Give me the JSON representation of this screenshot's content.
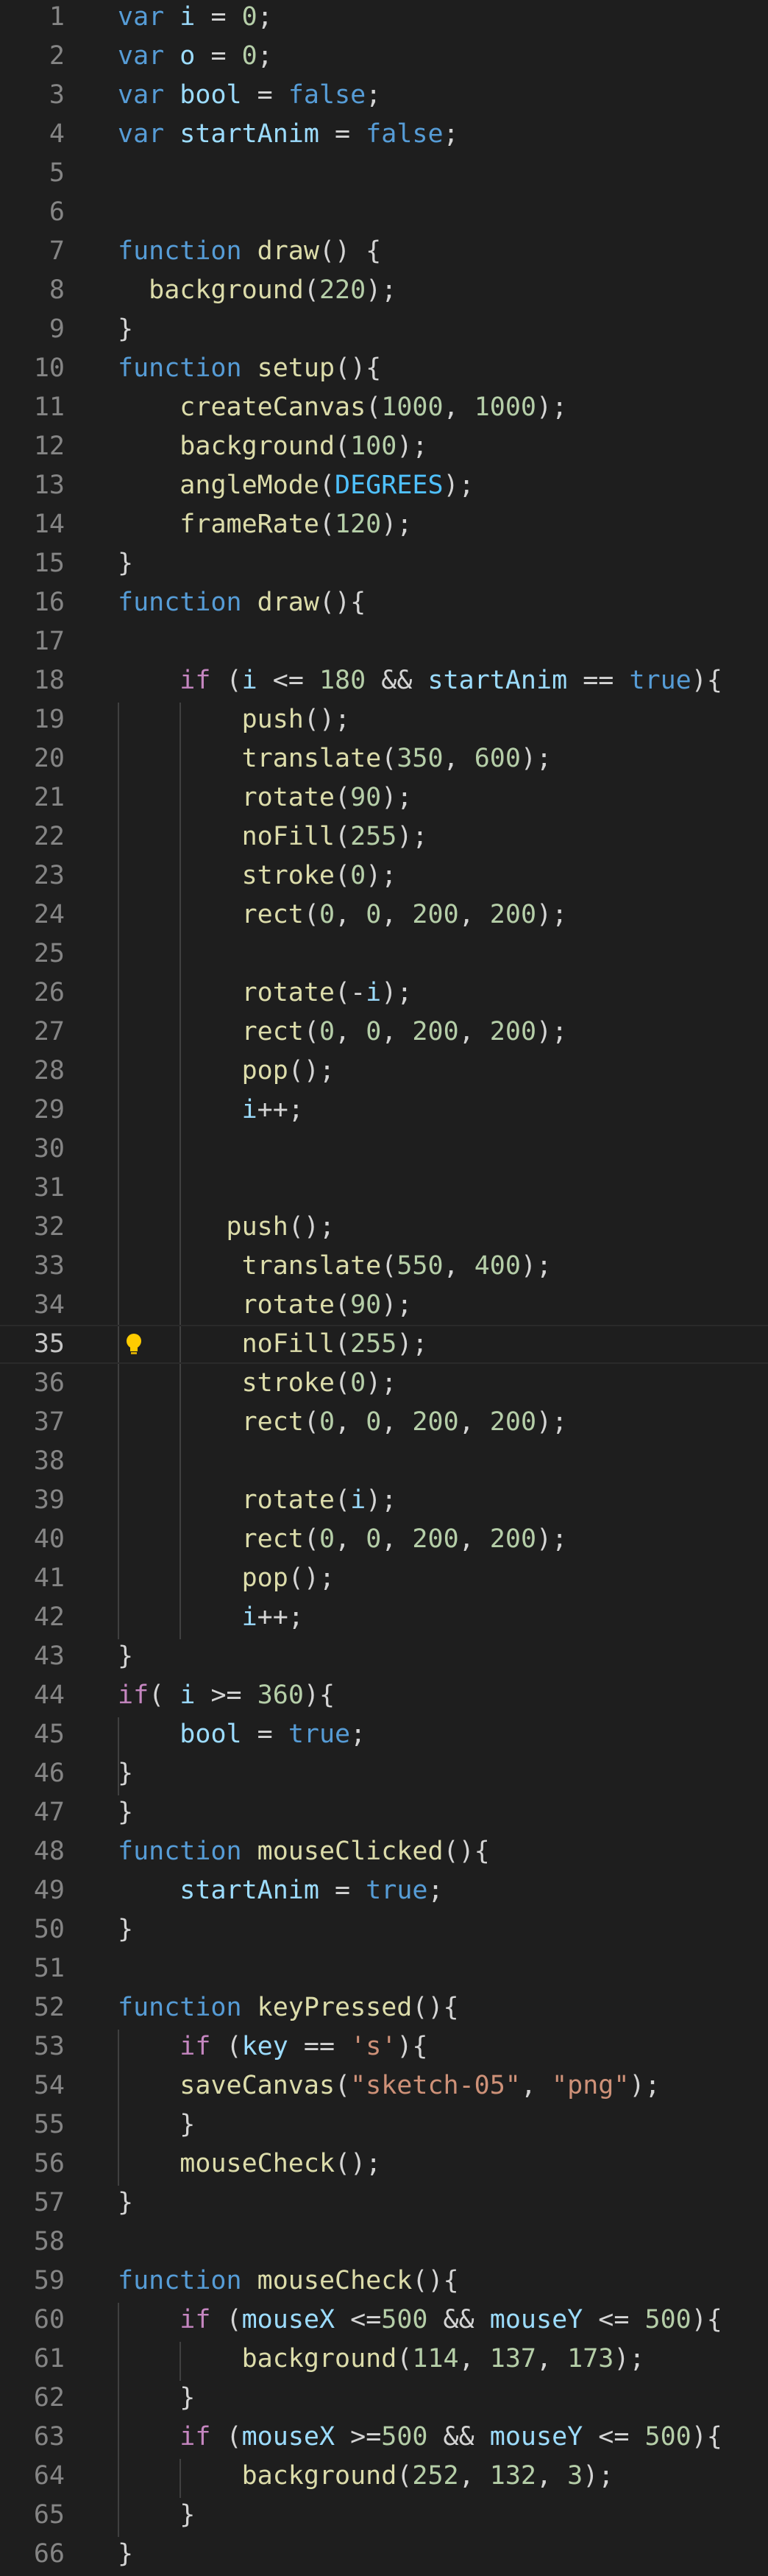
{
  "editor": {
    "current_line": 35,
    "lines": [
      {
        "n": "1",
        "toks": [
          [
            "var",
            "kw"
          ],
          [
            " "
          ],
          [
            "i",
            "var"
          ],
          [
            " = "
          ],
          [
            "0",
            "num"
          ],
          [
            ";"
          ]
        ]
      },
      {
        "n": "2",
        "toks": [
          [
            "var",
            "kw"
          ],
          [
            " "
          ],
          [
            "o",
            "var"
          ],
          [
            " = "
          ],
          [
            "0",
            "num"
          ],
          [
            ";"
          ]
        ]
      },
      {
        "n": "3",
        "toks": [
          [
            "var",
            "kw"
          ],
          [
            " "
          ],
          [
            "bool",
            "var"
          ],
          [
            " = "
          ],
          [
            "false",
            "kw"
          ],
          [
            ";"
          ]
        ]
      },
      {
        "n": "4",
        "toks": [
          [
            "var",
            "kw"
          ],
          [
            " "
          ],
          [
            "startAnim",
            "var"
          ],
          [
            " = "
          ],
          [
            "false",
            "kw"
          ],
          [
            ";"
          ]
        ]
      },
      {
        "n": "5",
        "toks": []
      },
      {
        "n": "6",
        "toks": []
      },
      {
        "n": "7",
        "toks": [
          [
            "function",
            "kw"
          ],
          [
            " "
          ],
          [
            "draw",
            "fn"
          ],
          [
            "() {"
          ]
        ]
      },
      {
        "n": "8",
        "toks": [
          [
            "  "
          ],
          [
            "background",
            "fn"
          ],
          [
            "("
          ],
          [
            "220",
            "num"
          ],
          [
            ");"
          ]
        ]
      },
      {
        "n": "9",
        "toks": [
          [
            "}"
          ]
        ]
      },
      {
        "n": "10",
        "toks": [
          [
            "function",
            "kw"
          ],
          [
            " "
          ],
          [
            "setup",
            "fn"
          ],
          [
            "(){"
          ]
        ]
      },
      {
        "n": "11",
        "toks": [
          [
            "    "
          ],
          [
            "createCanvas",
            "fn"
          ],
          [
            "("
          ],
          [
            "1000",
            "num"
          ],
          [
            ", "
          ],
          [
            "1000",
            "num"
          ],
          [
            ");"
          ]
        ]
      },
      {
        "n": "12",
        "toks": [
          [
            "    "
          ],
          [
            "background",
            "fn"
          ],
          [
            "("
          ],
          [
            "100",
            "num"
          ],
          [
            ");"
          ]
        ]
      },
      {
        "n": "13",
        "toks": [
          [
            "    "
          ],
          [
            "angleMode",
            "fn"
          ],
          [
            "("
          ],
          [
            "DEGREES",
            "con"
          ],
          [
            ");"
          ]
        ]
      },
      {
        "n": "14",
        "toks": [
          [
            "    "
          ],
          [
            "frameRate",
            "fn"
          ],
          [
            "("
          ],
          [
            "120",
            "num"
          ],
          [
            ");"
          ]
        ]
      },
      {
        "n": "15",
        "toks": [
          [
            "}"
          ]
        ]
      },
      {
        "n": "16",
        "toks": [
          [
            "function",
            "kw"
          ],
          [
            " "
          ],
          [
            "draw",
            "fn"
          ],
          [
            "(){"
          ]
        ]
      },
      {
        "n": "17",
        "toks": []
      },
      {
        "n": "18",
        "toks": [
          [
            "    "
          ],
          [
            "if",
            "ctl"
          ],
          [
            " ("
          ],
          [
            "i",
            "var"
          ],
          [
            " <= "
          ],
          [
            "180",
            "num"
          ],
          [
            " && "
          ],
          [
            "startAnim",
            "var"
          ],
          [
            " == "
          ],
          [
            "true",
            "kw"
          ],
          [
            "){"
          ]
        ]
      },
      {
        "n": "19",
        "toks": [
          [
            "        "
          ],
          [
            "push",
            "fn"
          ],
          [
            "();"
          ]
        ]
      },
      {
        "n": "20",
        "toks": [
          [
            "        "
          ],
          [
            "translate",
            "fn"
          ],
          [
            "("
          ],
          [
            "350",
            "num"
          ],
          [
            ", "
          ],
          [
            "600",
            "num"
          ],
          [
            ");"
          ]
        ]
      },
      {
        "n": "21",
        "toks": [
          [
            "        "
          ],
          [
            "rotate",
            "fn"
          ],
          [
            "("
          ],
          [
            "90",
            "num"
          ],
          [
            ");"
          ]
        ]
      },
      {
        "n": "22",
        "toks": [
          [
            "        "
          ],
          [
            "noFill",
            "fn"
          ],
          [
            "("
          ],
          [
            "255",
            "num"
          ],
          [
            ");"
          ]
        ]
      },
      {
        "n": "23",
        "toks": [
          [
            "        "
          ],
          [
            "stroke",
            "fn"
          ],
          [
            "("
          ],
          [
            "0",
            "num"
          ],
          [
            ");"
          ]
        ]
      },
      {
        "n": "24",
        "toks": [
          [
            "        "
          ],
          [
            "rect",
            "fn"
          ],
          [
            "("
          ],
          [
            "0",
            "num"
          ],
          [
            ", "
          ],
          [
            "0",
            "num"
          ],
          [
            ", "
          ],
          [
            "200",
            "num"
          ],
          [
            ", "
          ],
          [
            "200",
            "num"
          ],
          [
            ");"
          ]
        ]
      },
      {
        "n": "25",
        "toks": []
      },
      {
        "n": "26",
        "toks": [
          [
            "        "
          ],
          [
            "rotate",
            "fn"
          ],
          [
            "(-"
          ],
          [
            "i",
            "var"
          ],
          [
            ");"
          ]
        ]
      },
      {
        "n": "27",
        "toks": [
          [
            "        "
          ],
          [
            "rect",
            "fn"
          ],
          [
            "("
          ],
          [
            "0",
            "num"
          ],
          [
            ", "
          ],
          [
            "0",
            "num"
          ],
          [
            ", "
          ],
          [
            "200",
            "num"
          ],
          [
            ", "
          ],
          [
            "200",
            "num"
          ],
          [
            ");"
          ]
        ]
      },
      {
        "n": "28",
        "toks": [
          [
            "        "
          ],
          [
            "pop",
            "fn"
          ],
          [
            "();"
          ]
        ]
      },
      {
        "n": "29",
        "toks": [
          [
            "        "
          ],
          [
            "i",
            "var"
          ],
          [
            "++;"
          ]
        ]
      },
      {
        "n": "30",
        "toks": []
      },
      {
        "n": "31",
        "toks": []
      },
      {
        "n": "32",
        "toks": [
          [
            "       "
          ],
          [
            "push",
            "fn"
          ],
          [
            "();"
          ]
        ]
      },
      {
        "n": "33",
        "toks": [
          [
            "        "
          ],
          [
            "translate",
            "fn"
          ],
          [
            "("
          ],
          [
            "550",
            "num"
          ],
          [
            ", "
          ],
          [
            "400",
            "num"
          ],
          [
            ");"
          ]
        ]
      },
      {
        "n": "34",
        "toks": [
          [
            "        "
          ],
          [
            "rotate",
            "fn"
          ],
          [
            "("
          ],
          [
            "90",
            "num"
          ],
          [
            ");"
          ]
        ]
      },
      {
        "n": "35",
        "toks": [
          [
            "        "
          ],
          [
            "noFill",
            "fn"
          ],
          [
            "("
          ],
          [
            "255",
            "num"
          ],
          [
            ");"
          ]
        ]
      },
      {
        "n": "36",
        "toks": [
          [
            "        "
          ],
          [
            "stroke",
            "fn"
          ],
          [
            "("
          ],
          [
            "0",
            "num"
          ],
          [
            ");"
          ]
        ]
      },
      {
        "n": "37",
        "toks": [
          [
            "        "
          ],
          [
            "rect",
            "fn"
          ],
          [
            "("
          ],
          [
            "0",
            "num"
          ],
          [
            ", "
          ],
          [
            "0",
            "num"
          ],
          [
            ", "
          ],
          [
            "200",
            "num"
          ],
          [
            ", "
          ],
          [
            "200",
            "num"
          ],
          [
            ");"
          ]
        ]
      },
      {
        "n": "38",
        "toks": []
      },
      {
        "n": "39",
        "toks": [
          [
            "        "
          ],
          [
            "rotate",
            "fn"
          ],
          [
            "("
          ],
          [
            "i",
            "var"
          ],
          [
            ");"
          ]
        ]
      },
      {
        "n": "40",
        "toks": [
          [
            "        "
          ],
          [
            "rect",
            "fn"
          ],
          [
            "("
          ],
          [
            "0",
            "num"
          ],
          [
            ", "
          ],
          [
            "0",
            "num"
          ],
          [
            ", "
          ],
          [
            "200",
            "num"
          ],
          [
            ", "
          ],
          [
            "200",
            "num"
          ],
          [
            ");"
          ]
        ]
      },
      {
        "n": "41",
        "toks": [
          [
            "        "
          ],
          [
            "pop",
            "fn"
          ],
          [
            "();"
          ]
        ]
      },
      {
        "n": "42",
        "toks": [
          [
            "        "
          ],
          [
            "i",
            "var"
          ],
          [
            "++;"
          ]
        ]
      },
      {
        "n": "43",
        "toks": [
          [
            "}"
          ]
        ]
      },
      {
        "n": "44",
        "toks": [
          [
            "if",
            "ctl"
          ],
          [
            "( "
          ],
          [
            "i",
            "var"
          ],
          [
            " >= "
          ],
          [
            "360",
            "num"
          ],
          [
            "){"
          ]
        ]
      },
      {
        "n": "45",
        "toks": [
          [
            "    "
          ],
          [
            "bool",
            "var"
          ],
          [
            " = "
          ],
          [
            "true",
            "kw"
          ],
          [
            ";"
          ]
        ]
      },
      {
        "n": "46",
        "toks": [
          [
            "}"
          ]
        ]
      },
      {
        "n": "47",
        "toks": [
          [
            "}"
          ]
        ]
      },
      {
        "n": "48",
        "toks": [
          [
            "function",
            "kw"
          ],
          [
            " "
          ],
          [
            "mouseClicked",
            "fn"
          ],
          [
            "(){"
          ]
        ]
      },
      {
        "n": "49",
        "toks": [
          [
            "    "
          ],
          [
            "startAnim",
            "var"
          ],
          [
            " = "
          ],
          [
            "true",
            "kw"
          ],
          [
            ";"
          ]
        ]
      },
      {
        "n": "50",
        "toks": [
          [
            "}"
          ]
        ]
      },
      {
        "n": "51",
        "toks": []
      },
      {
        "n": "52",
        "toks": [
          [
            "function",
            "kw"
          ],
          [
            " "
          ],
          [
            "keyPressed",
            "fn"
          ],
          [
            "(){"
          ]
        ]
      },
      {
        "n": "53",
        "toks": [
          [
            "    "
          ],
          [
            "if",
            "ctl"
          ],
          [
            " ("
          ],
          [
            "key",
            "var"
          ],
          [
            " == "
          ],
          [
            "'s'",
            "str"
          ],
          [
            "){"
          ]
        ]
      },
      {
        "n": "54",
        "toks": [
          [
            "    "
          ],
          [
            "saveCanvas",
            "fn"
          ],
          [
            "("
          ],
          [
            "\"sketch-05\"",
            "str"
          ],
          [
            ", "
          ],
          [
            "\"png\"",
            "str"
          ],
          [
            ");"
          ]
        ]
      },
      {
        "n": "55",
        "toks": [
          [
            "    }"
          ]
        ]
      },
      {
        "n": "56",
        "toks": [
          [
            "    "
          ],
          [
            "mouseCheck",
            "fn"
          ],
          [
            "();"
          ]
        ]
      },
      {
        "n": "57",
        "toks": [
          [
            "}"
          ]
        ]
      },
      {
        "n": "58",
        "toks": []
      },
      {
        "n": "59",
        "toks": [
          [
            "function",
            "kw"
          ],
          [
            " "
          ],
          [
            "mouseCheck",
            "fn"
          ],
          [
            "(){"
          ]
        ]
      },
      {
        "n": "60",
        "toks": [
          [
            "    "
          ],
          [
            "if",
            "ctl"
          ],
          [
            " ("
          ],
          [
            "mouseX",
            "var"
          ],
          [
            " <="
          ],
          [
            "500",
            "num"
          ],
          [
            " && "
          ],
          [
            "mouseY",
            "var"
          ],
          [
            " <= "
          ],
          [
            "500",
            "num"
          ],
          [
            "){"
          ]
        ]
      },
      {
        "n": "61",
        "toks": [
          [
            "        "
          ],
          [
            "background",
            "fn"
          ],
          [
            "("
          ],
          [
            "114",
            "num"
          ],
          [
            ", "
          ],
          [
            "137",
            "num"
          ],
          [
            ", "
          ],
          [
            "173",
            "num"
          ],
          [
            ");"
          ]
        ]
      },
      {
        "n": "62",
        "toks": [
          [
            "    }"
          ]
        ]
      },
      {
        "n": "63",
        "toks": [
          [
            "    "
          ],
          [
            "if",
            "ctl"
          ],
          [
            " ("
          ],
          [
            "mouseX",
            "var"
          ],
          [
            " >="
          ],
          [
            "500",
            "num"
          ],
          [
            " && "
          ],
          [
            "mouseY",
            "var"
          ],
          [
            " <= "
          ],
          [
            "500",
            "num"
          ],
          [
            "){"
          ]
        ]
      },
      {
        "n": "64",
        "toks": [
          [
            "        "
          ],
          [
            "background",
            "fn"
          ],
          [
            "("
          ],
          [
            "252",
            "num"
          ],
          [
            ", "
          ],
          [
            "132",
            "num"
          ],
          [
            ", "
          ],
          [
            "3",
            "num"
          ],
          [
            ");"
          ]
        ]
      },
      {
        "n": "65",
        "toks": [
          [
            "    }"
          ]
        ]
      },
      {
        "n": "66",
        "toks": [
          [
            "}"
          ]
        ]
      },
      {
        "n": "67",
        "toks": []
      }
    ]
  }
}
